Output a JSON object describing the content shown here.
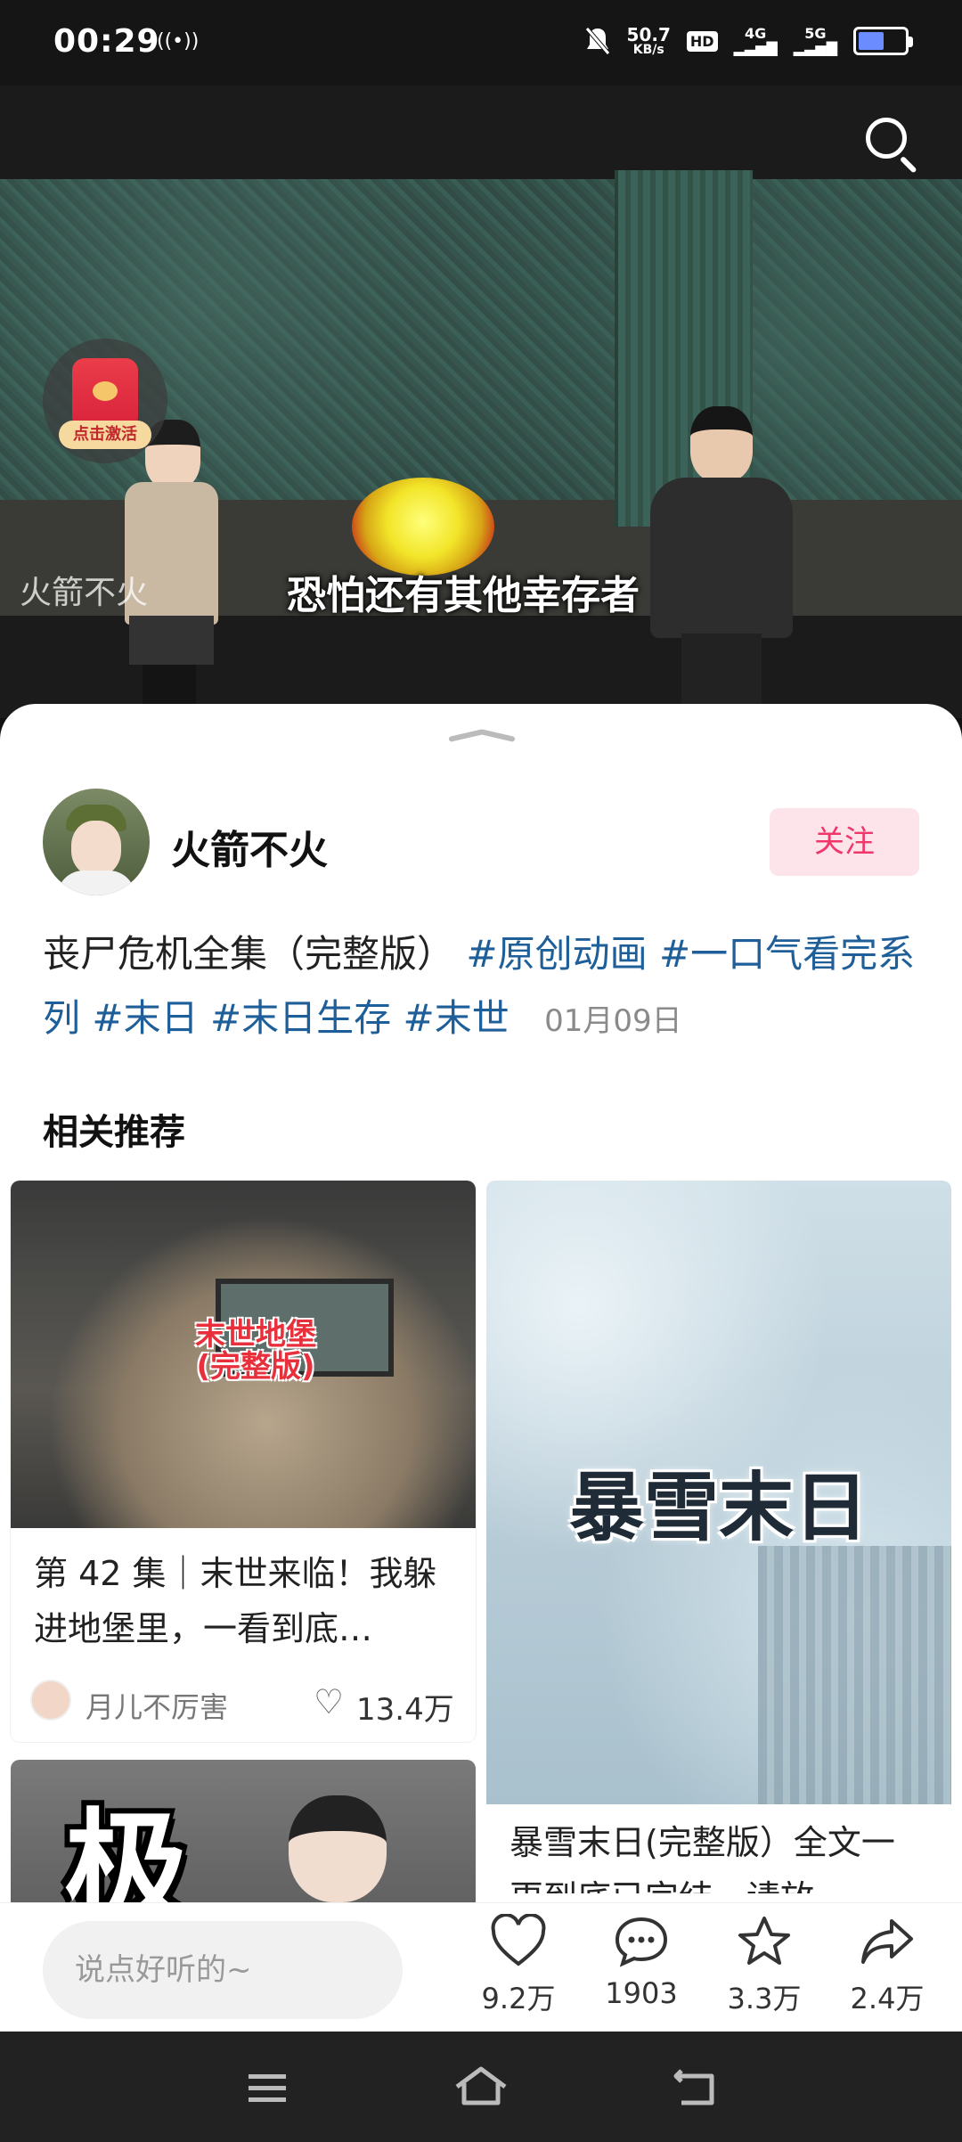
{
  "status_bar": {
    "time": "00:29",
    "net_speed_value": "50.7",
    "net_speed_unit": "KB/s",
    "sim1": "4G",
    "sim2": "5G",
    "battery_percent": 55
  },
  "video": {
    "watermark": "火箭不火",
    "subtitle": "恐怕还有其他幸存者",
    "redpacket_label": "点击激活"
  },
  "post": {
    "author": "火箭不火",
    "follow_label": "关注",
    "desc_text": "丧尸危机全集（完整版）",
    "tags": [
      "#原创动画",
      "#一口气看完系列",
      "#末日",
      "#末日生存",
      "#末世"
    ],
    "date": "01月09日"
  },
  "related": {
    "section_title": "相关推荐",
    "cards": [
      {
        "thumb_title": "末世地堡\n(完整版)",
        "title": "第 42 集｜末世来临！我躲进地堡里，一看到底…",
        "author": "月儿不厉害",
        "likes": "13.4万"
      },
      {
        "thumb_title": "暴雪末日",
        "title": "暴雪末日(完整版）全文一更到底已完结，请放…"
      },
      {
        "thumb_title": "极"
      }
    ]
  },
  "action_bar": {
    "comment_placeholder": "说点好听的~",
    "like_count": "9.2万",
    "comment_count": "1903",
    "favorite_count": "3.3万",
    "share_count": "2.4万"
  },
  "colors": {
    "accent_pink": "#f0366a",
    "tag_blue": "#1f5f99"
  },
  "icons": [
    "search-icon",
    "heart-icon",
    "comment-icon",
    "star-icon",
    "share-icon",
    "menu-icon",
    "home-icon",
    "back-icon"
  ]
}
